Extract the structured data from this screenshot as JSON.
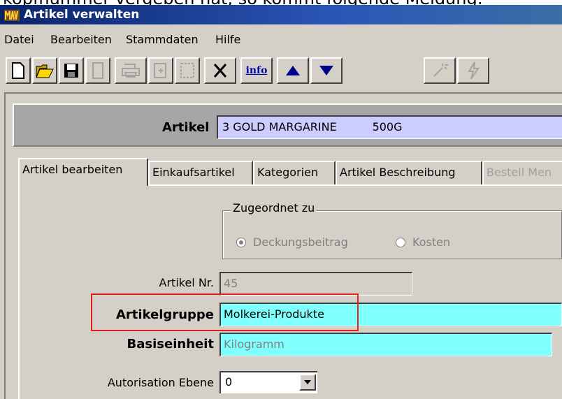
{
  "top_text": "kopfnummer vergeben hat, so kommt folgende Meldung:",
  "window": {
    "title": "Artikel verwalten"
  },
  "menu": [
    "Datei",
    "Bearbeiten",
    "Stammdaten",
    "Hilfe"
  ],
  "toolbar": {
    "buttons": [
      {
        "icon": "new-document-icon",
        "enabled": true
      },
      {
        "icon": "open-folder-icon",
        "enabled": true
      },
      {
        "icon": "save-disk-icon",
        "enabled": true
      },
      {
        "icon": "blank-page-icon",
        "enabled": false
      },
      {
        "icon": "print-icon",
        "enabled": false
      },
      {
        "icon": "print-preview-icon",
        "enabled": false
      },
      {
        "icon": "page-setup-icon",
        "enabled": false
      },
      {
        "icon": "delete-x-icon",
        "enabled": true
      },
      {
        "icon": "info-icon",
        "enabled": true
      },
      {
        "icon": "arrow-up-icon",
        "enabled": true
      },
      {
        "icon": "arrow-down-icon",
        "enabled": true
      },
      {
        "icon": "wand-icon",
        "enabled": false
      },
      {
        "icon": "lightning-icon",
        "enabled": false
      }
    ],
    "info_label": "info"
  },
  "header": {
    "label": "Artikel",
    "value": "3 GOLD MARGARINE          500G"
  },
  "tabs": [
    {
      "label": "Artikel bearbeiten",
      "active": true
    },
    {
      "label": "Einkaufsartikel"
    },
    {
      "label": "Kategorien"
    },
    {
      "label": "Artikel Beschreibung"
    },
    {
      "label": "Bestell Men",
      "disabled": true
    }
  ],
  "group": {
    "title": "Zugeordnet zu",
    "options": [
      {
        "label": "Deckungsbeitrag",
        "selected": true
      },
      {
        "label": "Kosten",
        "selected": false
      }
    ]
  },
  "form": {
    "artikel_nr": {
      "label": "Artikel Nr.",
      "value": "45"
    },
    "artikelgruppe": {
      "label": "Artikelgruppe",
      "value": "Molkerei-Produkte"
    },
    "basiseinheit": {
      "label": "Basiseinheit",
      "value": "Kilogramm"
    },
    "autorisation": {
      "label": "Autorisation Ebene",
      "value": "0"
    }
  },
  "colors": {
    "title_gradient_start": "#0a246a",
    "header_field": "#ccccff",
    "cyan_field": "#80ffff",
    "highlight": "#e32020"
  }
}
